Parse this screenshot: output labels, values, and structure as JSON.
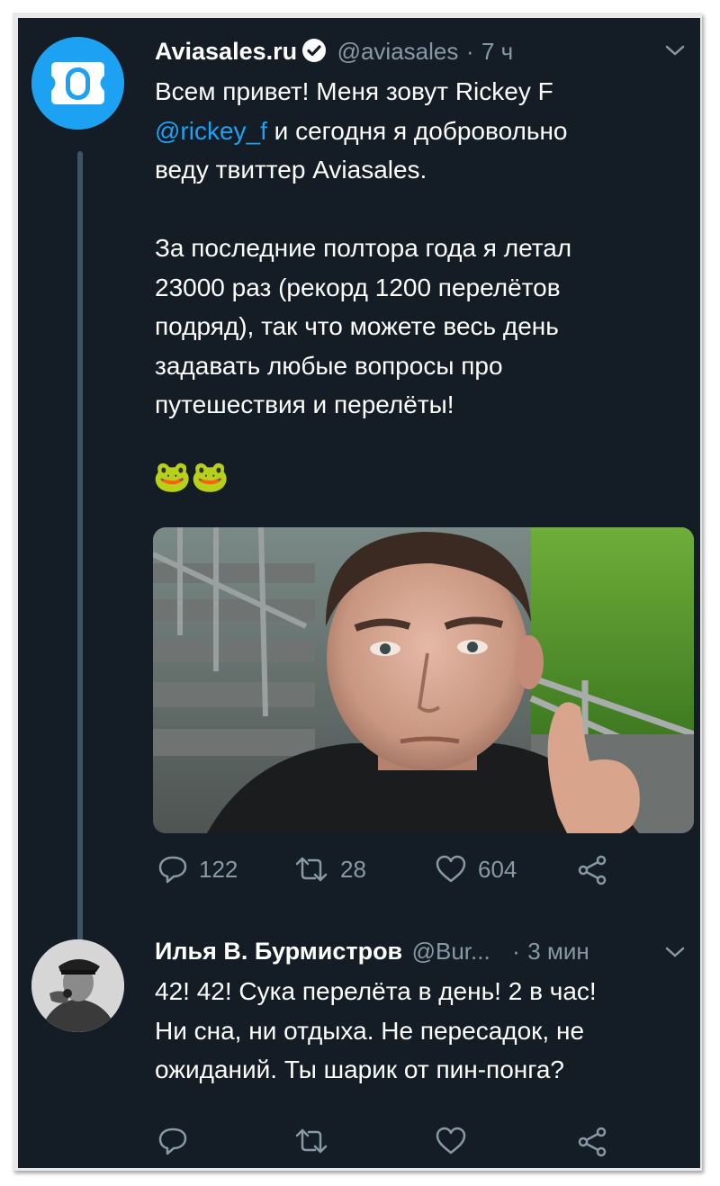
{
  "tweet": {
    "author_name": "Aviasales.ru",
    "handle": "@aviasales",
    "separator": "·",
    "time": "7 ч",
    "text_line1": "Всем привет! Меня зовут Rickey F",
    "mention": "@rickey_f",
    "text_line2_rest": " и сегодня я добровольно",
    "text_line3": "веду твиттер Aviasales.",
    "paragraph2": "За последние полтора года я летал\n23000 раз (рекорд 1200 перелётов\nподряд), так что можете весь день\nзадавать любые вопросы про\nпутешествия и перелёты!",
    "emoji": "🐸🐸",
    "replies": "122",
    "retweets": "28",
    "likes": "604"
  },
  "reply": {
    "author_name": "Илья В. Бурмистров",
    "handle": "@Bur...",
    "separator": "·",
    "time": "3 мин",
    "text": "42! 42! Сука перелёта в день! 2 в час!\nНи сна, ни отдыха. Не пересадок, не\nожиданий.  Ты шарик от пин-понга?"
  },
  "colors": {
    "background": "#141d26",
    "accent": "#1da1f2",
    "muted": "#8899a6",
    "text": "#ffffff"
  },
  "icons": [
    "aviasales-logo-icon",
    "verified-badge-icon",
    "chevron-down-icon",
    "reply-icon",
    "retweet-icon",
    "like-icon",
    "share-icon"
  ]
}
